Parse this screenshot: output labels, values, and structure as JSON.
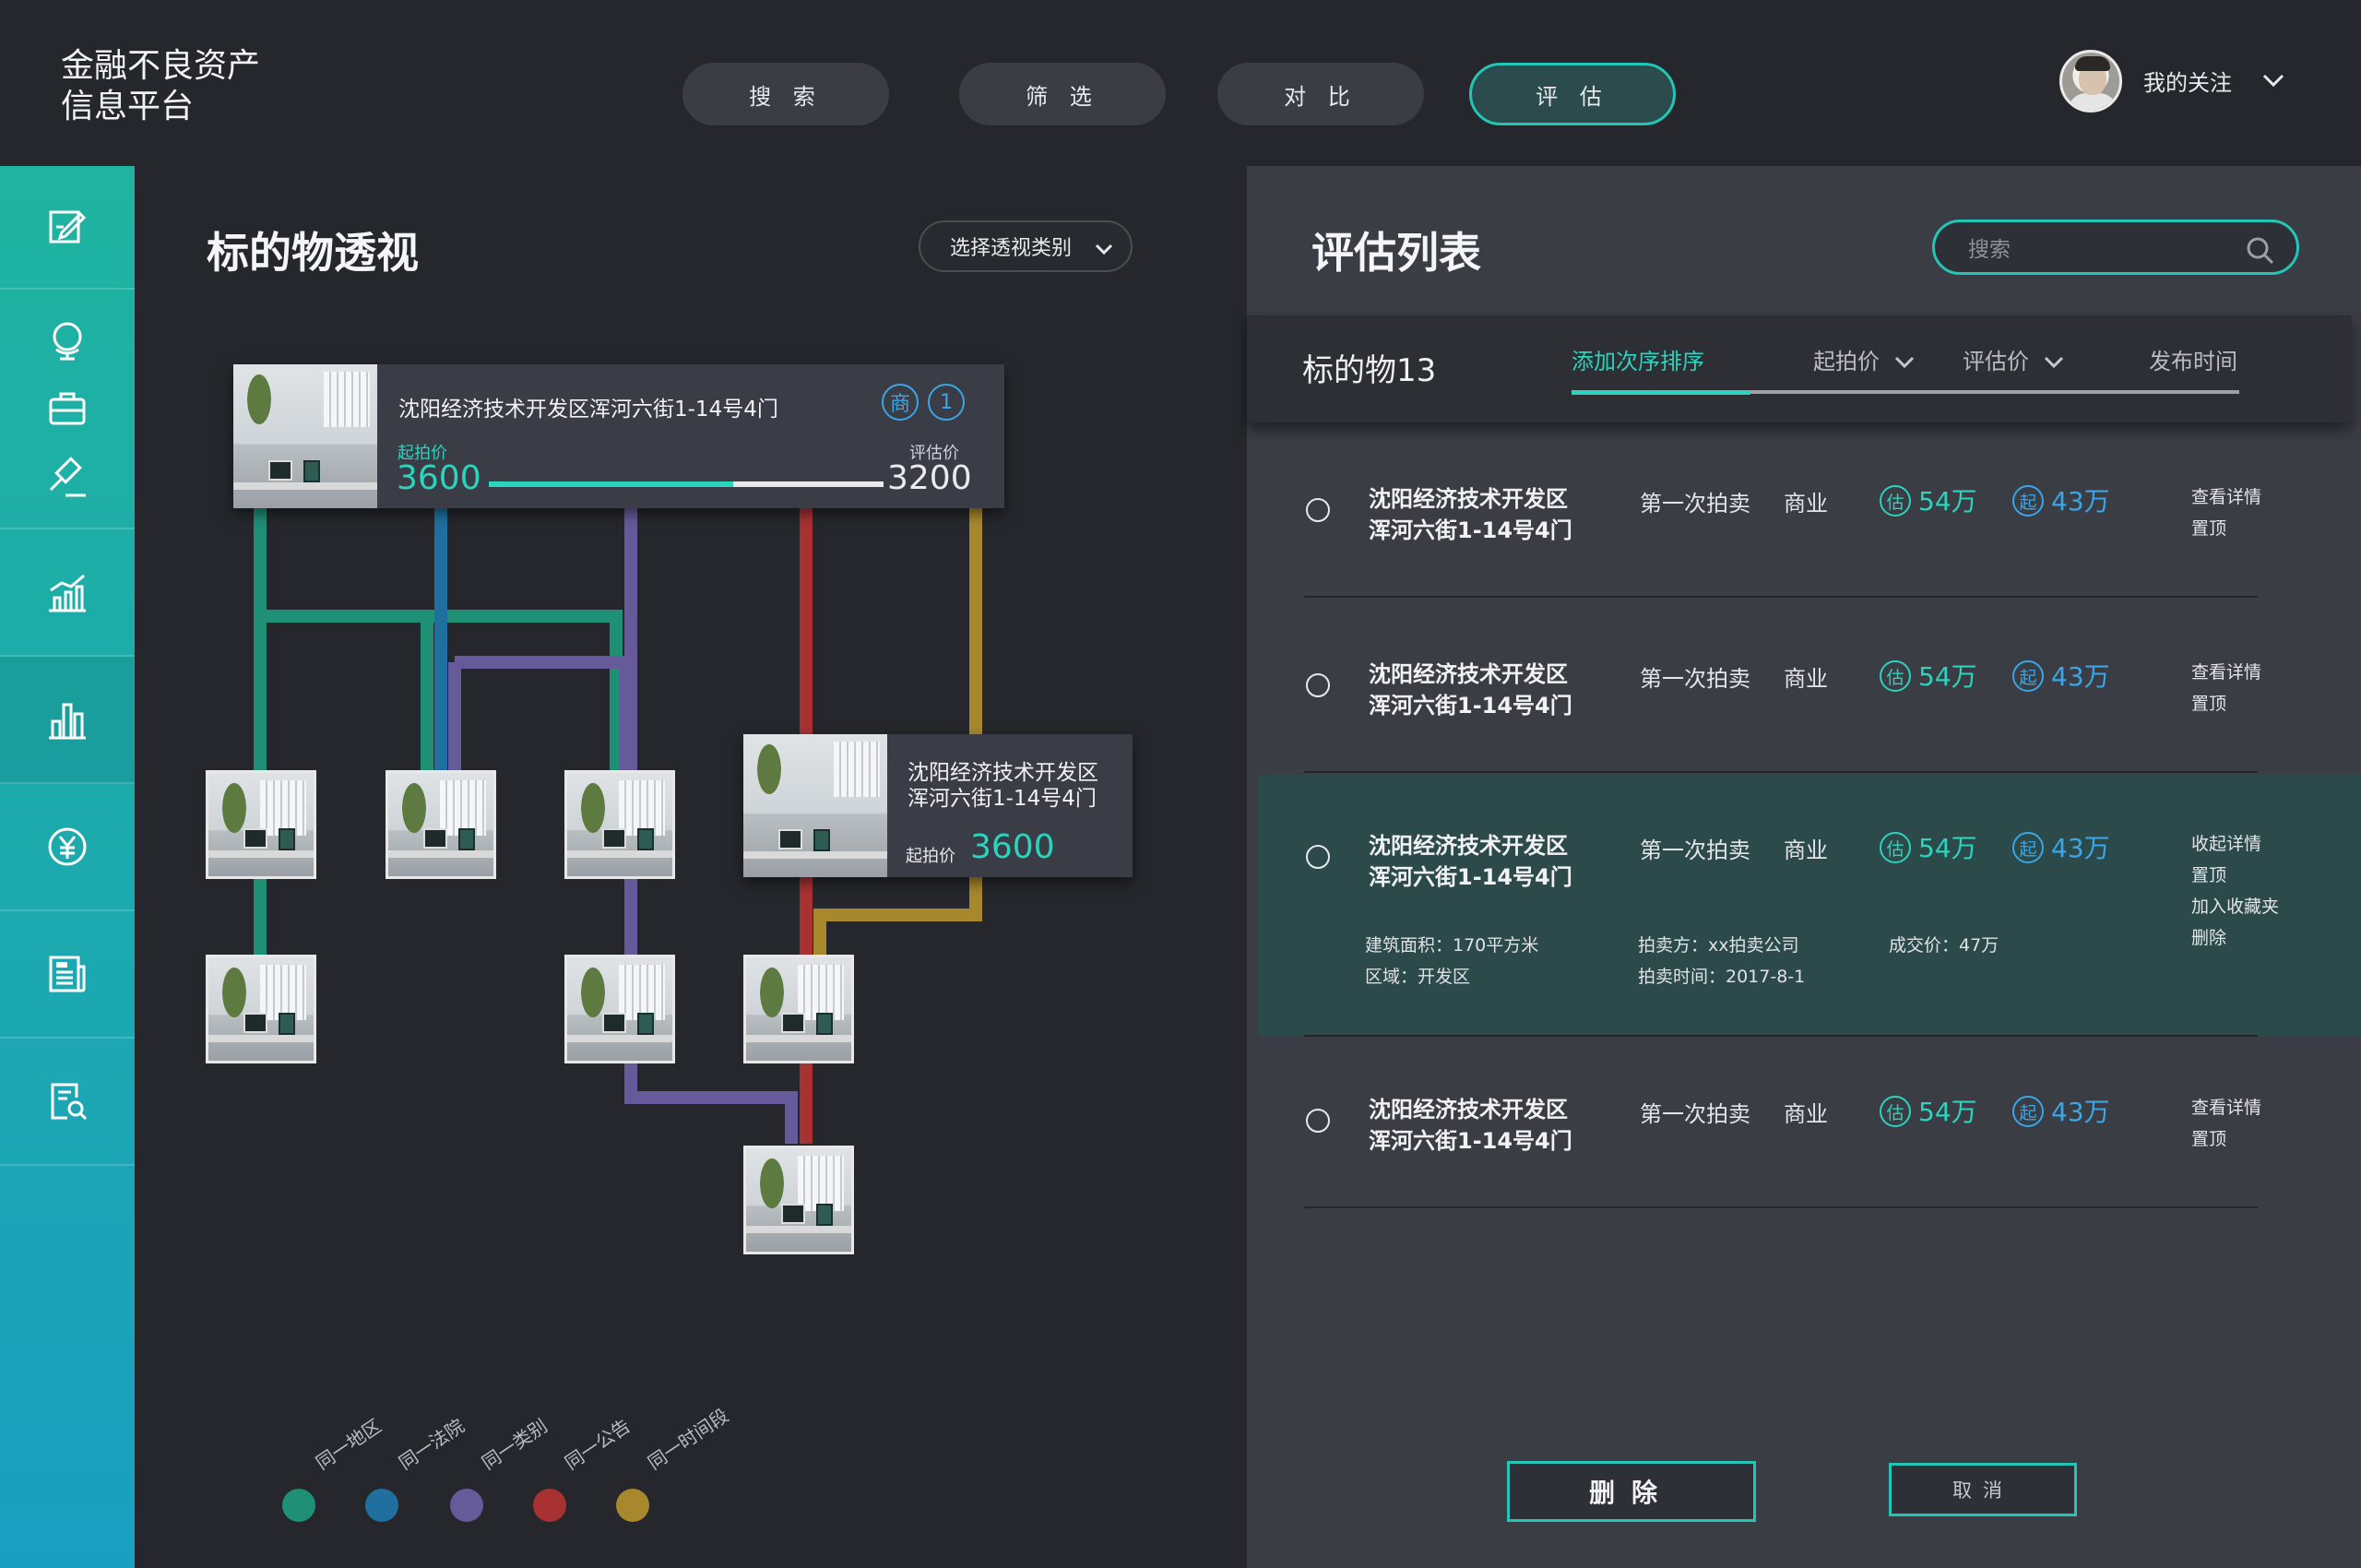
{
  "app": {
    "title_line1": "金融不良资产",
    "title_line2": "信息平台"
  },
  "nav": [
    {
      "label": "搜 索"
    },
    {
      "label": "筛 选"
    },
    {
      "label": "对 比"
    },
    {
      "label": "评 估",
      "active": true
    }
  ],
  "user": {
    "follow_label": "我的关注"
  },
  "sidebar": {
    "icons": [
      "edit-icon",
      "globe-icon",
      "briefcase-icon",
      "gavel-icon",
      "chart-growth-icon",
      "bar-chart-icon",
      "yuan-icon",
      "news-icon",
      "doc-search-icon"
    ],
    "active_index": 5
  },
  "left": {
    "title": "标的物透视",
    "select_label": "选择透视类别",
    "main_node": {
      "name": "沈阳经济技术开发区浑河六街1-14号4门",
      "badge_shang": "商",
      "badge_num": "1",
      "start_label": "起拍价",
      "start_value": "3600",
      "eval_label": "评估价",
      "eval_value": "3200",
      "progress": 0.62
    },
    "side_node": {
      "name_line1": "沈阳经济技术开发区",
      "name_line2": "浑河六街1-14号4门",
      "start_label": "起拍价",
      "start_value": "3600"
    },
    "legend": [
      {
        "label": "同一地区",
        "color": "#1f8f75"
      },
      {
        "label": "同一法院",
        "color": "#1f6f9f"
      },
      {
        "label": "同一类别",
        "color": "#675a9a"
      },
      {
        "label": "同一公告",
        "color": "#a83232"
      },
      {
        "label": "同一时间段",
        "color": "#a8882c"
      }
    ]
  },
  "right": {
    "title": "评估列表",
    "search_placeholder": "搜索",
    "count_label": "标的物13",
    "sort_tabs": [
      "添加次序排序",
      "起拍价",
      "评估价",
      "发布时间"
    ],
    "rows": [
      {
        "name_line1": "沈阳经济技术开发区",
        "name_line2": "浑河六街1-14号4门",
        "round": "第一次拍卖",
        "type": "商业",
        "eval_badge": "估",
        "eval_value": "54万",
        "start_badge": "起",
        "start_value": "43万",
        "actions": [
          "查看详情",
          "置顶"
        ]
      },
      {
        "name_line1": "沈阳经济技术开发区",
        "name_line2": "浑河六街1-14号4门",
        "round": "第一次拍卖",
        "type": "商业",
        "eval_badge": "估",
        "eval_value": "54万",
        "start_badge": "起",
        "start_value": "43万",
        "actions": [
          "查看详情",
          "置顶"
        ]
      },
      {
        "name_line1": "沈阳经济技术开发区",
        "name_line2": "浑河六街1-14号4门",
        "round": "第一次拍卖",
        "type": "商业",
        "eval_badge": "估",
        "eval_value": "54万",
        "start_badge": "起",
        "start_value": "43万",
        "actions": [
          "收起详情",
          "置顶",
          "加入收藏夹",
          "删除"
        ],
        "selected": true,
        "details": {
          "area": "建筑面积：170平方米",
          "region": "区域：开发区",
          "seller": "拍卖方：xx拍卖公司",
          "time": "拍卖时间：2017-8-1",
          "deal": "成交价：47万"
        }
      },
      {
        "name_line1": "沈阳经济技术开发区",
        "name_line2": "浑河六街1-14号4门",
        "round": "第一次拍卖",
        "type": "商业",
        "eval_badge": "估",
        "eval_value": "54万",
        "start_badge": "起",
        "start_value": "43万",
        "actions": [
          "查看详情",
          "置顶"
        ]
      }
    ],
    "delete_label": "删除",
    "cancel_label": "取消"
  },
  "colors": {
    "accent": "#2cd3bd",
    "blue": "#3aa6e8",
    "panel": "#3a3d44",
    "bg": "#25272c"
  }
}
